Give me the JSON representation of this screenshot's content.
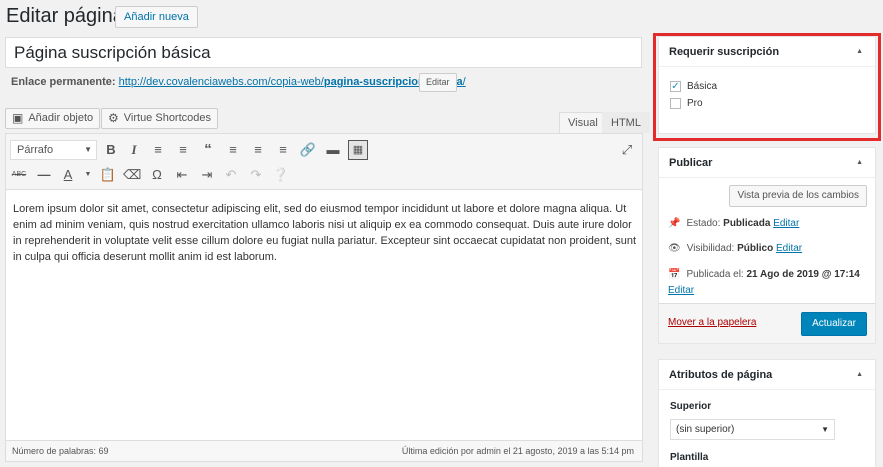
{
  "header": {
    "title": "Editar página",
    "add_new_label": "Añadir nueva"
  },
  "post": {
    "title": "Página suscripción básica",
    "permalink_label": "Enlace permanente:",
    "permalink_base": "http://dev.covalenciawebs.com/copia-web/",
    "permalink_slug": "pagina-suscripcion-basica",
    "permalink_tail": "/",
    "edit_label": "Editar"
  },
  "media": {
    "add_media_label": "Añadir objeto",
    "virtue_label": "Virtue Shortcodes"
  },
  "editor": {
    "tabs": [
      {
        "label": "Visual"
      },
      {
        "label": "HTML"
      }
    ],
    "active_tab": "Visual",
    "format_select": "Párrafo",
    "content": "Lorem ipsum dolor sit amet, consectetur adipiscing elit, sed do eiusmod tempor incididunt ut labore et dolore magna aliqua. Ut enim ad minim veniam, quis nostrud exercitation ullamco laboris nisi ut aliquip ex ea commodo consequat. Duis aute irure dolor in reprehenderit in voluptate velit esse cillum dolore eu fugiat nulla pariatur. Excepteur sint occaecat cupidatat non proident, sunt in culpa qui officia deserunt mollit anim id est laborum.",
    "word_count": "Número de palabras: 69",
    "last_edit": "Última edición por admin el 21 agosto, 2019 a las 5:14 pm",
    "toolbar_icons": [
      "bold-icon",
      "italic-icon",
      "bullet-list-icon",
      "numbered-list-icon",
      "blockquote-icon",
      "align-left-icon",
      "align-center-icon",
      "align-right-icon",
      "link-icon",
      "read-more-icon",
      "toolbar-toggle-icon",
      "fullscreen-icon",
      "strikethrough-icon",
      "horizontal-line-icon",
      "text-color-icon",
      "paste-text-icon",
      "clear-formatting-icon",
      "special-character-icon",
      "outdent-icon",
      "indent-icon",
      "undo-icon",
      "redo-icon",
      "help-icon"
    ]
  },
  "require_subscription": {
    "title": "Requerir suscripción",
    "options": [
      {
        "label": "Básica",
        "checked": true
      },
      {
        "label": "Pro",
        "checked": false
      }
    ]
  },
  "publish": {
    "title": "Publicar",
    "preview_label": "Vista previa de los cambios",
    "status_label": "Estado:",
    "status_value": "Publicada",
    "visibility_label": "Visibilidad:",
    "visibility_value": "Público",
    "published_label": "Publicada el:",
    "published_value": "21 Ago de 2019 @ 17:14",
    "edit_label": "Editar",
    "trash_label": "Mover a la papelera",
    "update_label": "Actualizar"
  },
  "page_attributes": {
    "title": "Atributos de página",
    "parent_label": "Superior",
    "parent_value": "(sin superior)",
    "template_label": "Plantilla"
  },
  "colors": {
    "highlight_frame": "#e32b2b",
    "primary_button": "#0085ba",
    "link": "#0073aa"
  }
}
